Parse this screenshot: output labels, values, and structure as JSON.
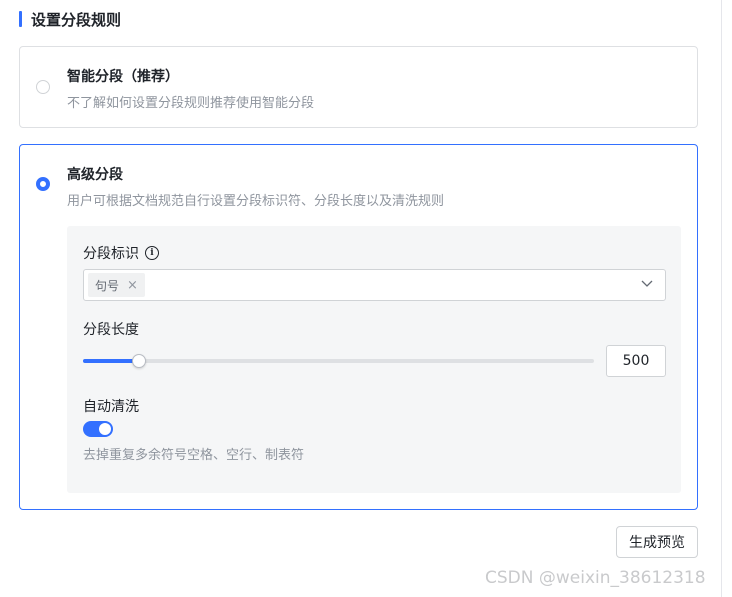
{
  "section": {
    "title": "设置分段规则"
  },
  "options": [
    {
      "title": "智能分段（推荐）",
      "description": "不了解如何设置分段规则推荐使用智能分段",
      "selected": false
    },
    {
      "title": "高级分段",
      "description": "用户可根据文档规范自行设置分段标识符、分段长度以及清洗规则",
      "selected": true
    }
  ],
  "advanced": {
    "separator": {
      "label": "分段标识",
      "info_icon": "info-circle-icon",
      "tags": [
        "句号"
      ],
      "tag_close_icon": "close-icon",
      "dropdown_icon": "chevron-down-icon"
    },
    "length": {
      "label": "分段长度",
      "value": "500",
      "slider_fraction": 0.11
    },
    "clean": {
      "label": "自动清洗",
      "enabled": true,
      "description": "去掉重复多余符号空格、空行、制表符"
    }
  },
  "actions": {
    "preview_label": "生成预览"
  },
  "watermark": "CSDN @weixin_38612318",
  "colors": {
    "accent": "#3370ff",
    "muted_text": "#8f959e",
    "border": "#dee0e3",
    "panel_bg": "#f5f6f7"
  }
}
